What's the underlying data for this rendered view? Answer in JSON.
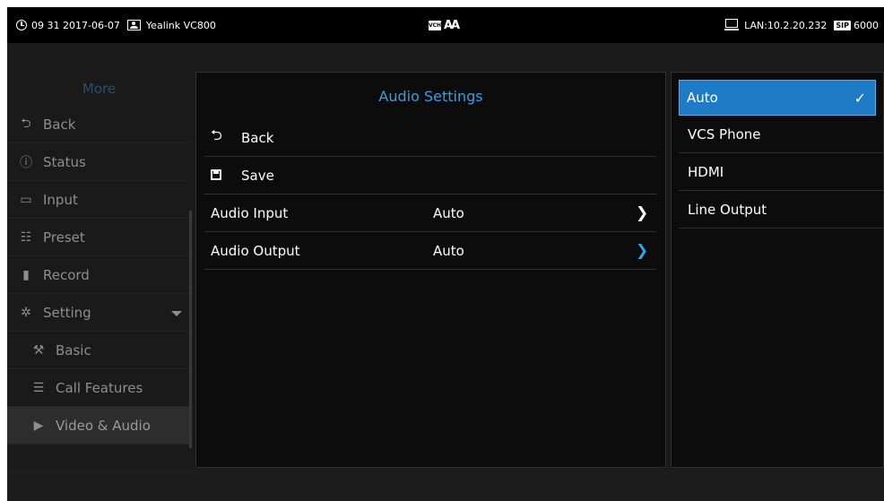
{
  "status_bar": {
    "time_date": "09 31 2017-06-07",
    "device_name": "Yealink VC800",
    "center_badge": "VCH",
    "center_font_icon": "AA",
    "network": "LAN:10.2.20.232",
    "sip_badge": "SIP",
    "sip_account": "6000"
  },
  "left_menu": {
    "title": "More",
    "items": [
      {
        "label": "Back",
        "icon": "back-arrow-icon",
        "glyph": "⮌"
      },
      {
        "label": "Status",
        "icon": "info-icon",
        "glyph": "ⓘ"
      },
      {
        "label": "Input",
        "icon": "input-icon",
        "glyph": "▭"
      },
      {
        "label": "Preset",
        "icon": "preset-icon",
        "glyph": "☷"
      },
      {
        "label": "Record",
        "icon": "record-icon",
        "glyph": "▮"
      },
      {
        "label": "Setting",
        "icon": "gear-icon",
        "glyph": "✲"
      },
      {
        "label": "Basic",
        "icon": "wrench-icon",
        "glyph": "⚒"
      },
      {
        "label": "Call Features",
        "icon": "call-features-icon",
        "glyph": "☰"
      },
      {
        "label": "Video & Audio",
        "icon": "video-audio-icon",
        "glyph": "▶"
      }
    ]
  },
  "center_panel": {
    "title": "Audio Settings",
    "back_label": "Back",
    "save_label": "Save",
    "rows": [
      {
        "label": "Audio Input",
        "value": "Auto"
      },
      {
        "label": "Audio Output",
        "value": "Auto"
      }
    ]
  },
  "right_panel": {
    "options": [
      "Auto",
      "VCS Phone",
      "HDMI",
      "Line Output"
    ],
    "selected": "Auto"
  },
  "colors": {
    "accent": "#3a9ee0",
    "selected_bg": "#1f7bc6"
  }
}
